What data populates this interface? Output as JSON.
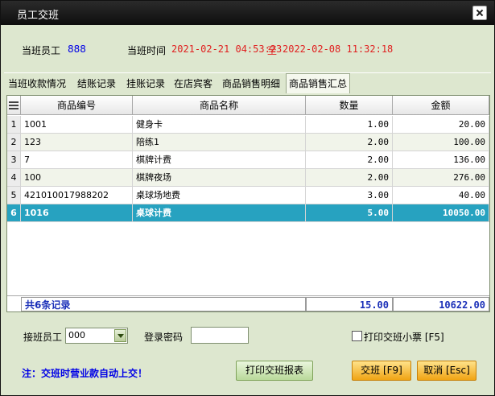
{
  "window": {
    "title": "员工交班"
  },
  "info": {
    "employee_label": "当班员工",
    "employee_value": "888",
    "time_label": "当班时间",
    "time_start": "2021-02-21 04:53:23",
    "time_sep": "至",
    "time_end": "2022-02-08 11:32:18"
  },
  "tabs": [
    "当班收款情况",
    "结账记录",
    "挂账记录",
    "在店宾客",
    "商品销售明细",
    "商品销售汇总"
  ],
  "active_tab": "商品销售汇总",
  "grid": {
    "columns": [
      "",
      "商品编号",
      "商品名称",
      "数量",
      "金额"
    ],
    "rows": [
      {
        "idx": "1",
        "code": "1001",
        "name": "健身卡",
        "qty": "1.00",
        "amount": "20.00"
      },
      {
        "idx": "2",
        "code": "123",
        "name": "陪练1",
        "qty": "2.00",
        "amount": "100.00"
      },
      {
        "idx": "3",
        "code": "7",
        "name": "棋牌计费",
        "qty": "2.00",
        "amount": "136.00"
      },
      {
        "idx": "4",
        "code": "100",
        "name": "棋牌夜场",
        "qty": "2.00",
        "amount": "276.00"
      },
      {
        "idx": "5",
        "code": "421010017988202",
        "name": "桌球场地费",
        "qty": "3.00",
        "amount": "40.00"
      },
      {
        "idx": "6",
        "code": "1016",
        "name": "桌球计费",
        "qty": "5.00",
        "amount": "10050.00"
      }
    ],
    "selected_row": 5,
    "footer": {
      "count_label": "共6条记录",
      "qty_total": "15.00",
      "amount_total": "10622.00"
    }
  },
  "bottom": {
    "next_employee_label": "接班员工",
    "next_employee_value": "000",
    "password_label": "登录密码",
    "password_value": "",
    "print_slip_label": "打印交班小票 [F5]",
    "print_report_button": "打印交班报表",
    "handover_button": "交班 [F9]",
    "cancel_button": "取消 [Esc]",
    "note": "注：交班时营业款自动上交！"
  }
}
